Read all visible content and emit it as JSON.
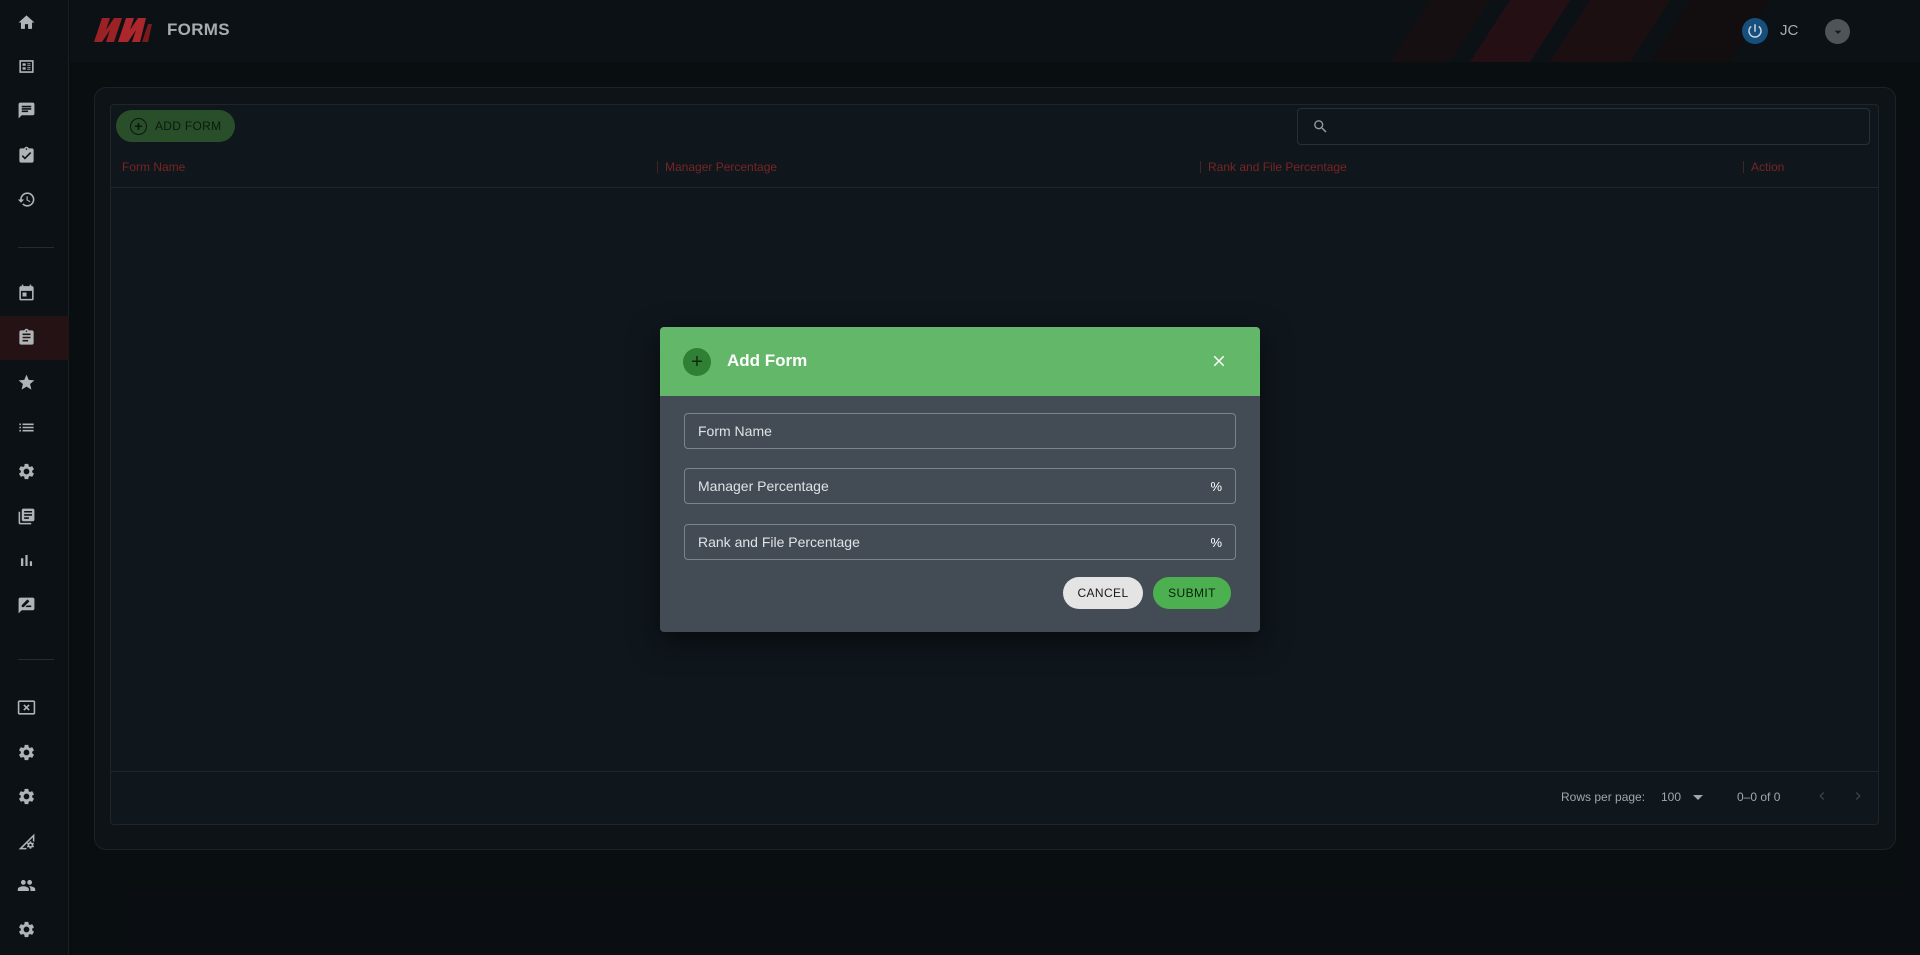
{
  "header": {
    "title": "FORMS",
    "user_initials": "JC"
  },
  "sidebar": {
    "items": [
      {
        "icon": "home-icon"
      },
      {
        "icon": "dashboard-list-icon"
      },
      {
        "icon": "chat-icon"
      },
      {
        "icon": "assignment-check-icon"
      },
      {
        "icon": "history-icon"
      },
      {
        "icon": "calendar-icon"
      },
      {
        "icon": "clipboard-icon",
        "active": true
      },
      {
        "icon": "star-icon"
      },
      {
        "icon": "list-icon"
      },
      {
        "icon": "gear-icon"
      },
      {
        "icon": "library-icon"
      },
      {
        "icon": "bar-chart-icon"
      },
      {
        "icon": "feedback-icon"
      },
      {
        "icon": "cancel-box-icon"
      },
      {
        "icon": "settings-icon"
      },
      {
        "icon": "settings-alt-icon"
      },
      {
        "icon": "network-settings-icon"
      },
      {
        "icon": "people-icon"
      },
      {
        "icon": "settings-bottom-icon"
      }
    ]
  },
  "toolbar": {
    "add_form_label": "ADD FORM",
    "search_placeholder": ""
  },
  "table": {
    "columns": [
      "Form Name",
      "Manager Percentage",
      "Rank and File Percentage",
      "Action"
    ],
    "rows": []
  },
  "pagination": {
    "rows_per_page_label": "Rows per page:",
    "rows_per_page_value": "100",
    "range": "0–0 of 0"
  },
  "modal": {
    "title": "Add Form",
    "fields": [
      {
        "placeholder": "Form Name",
        "unit": ""
      },
      {
        "placeholder": "Manager Percentage",
        "unit": "%"
      },
      {
        "placeholder": "Rank and File Percentage",
        "unit": "%"
      }
    ],
    "cancel_label": "CANCEL",
    "submit_label": "SUBMIT"
  },
  "colors": {
    "accent_red": "#8a2a28",
    "modal_header_green": "#63b769",
    "submit_green": "#4caf50"
  }
}
